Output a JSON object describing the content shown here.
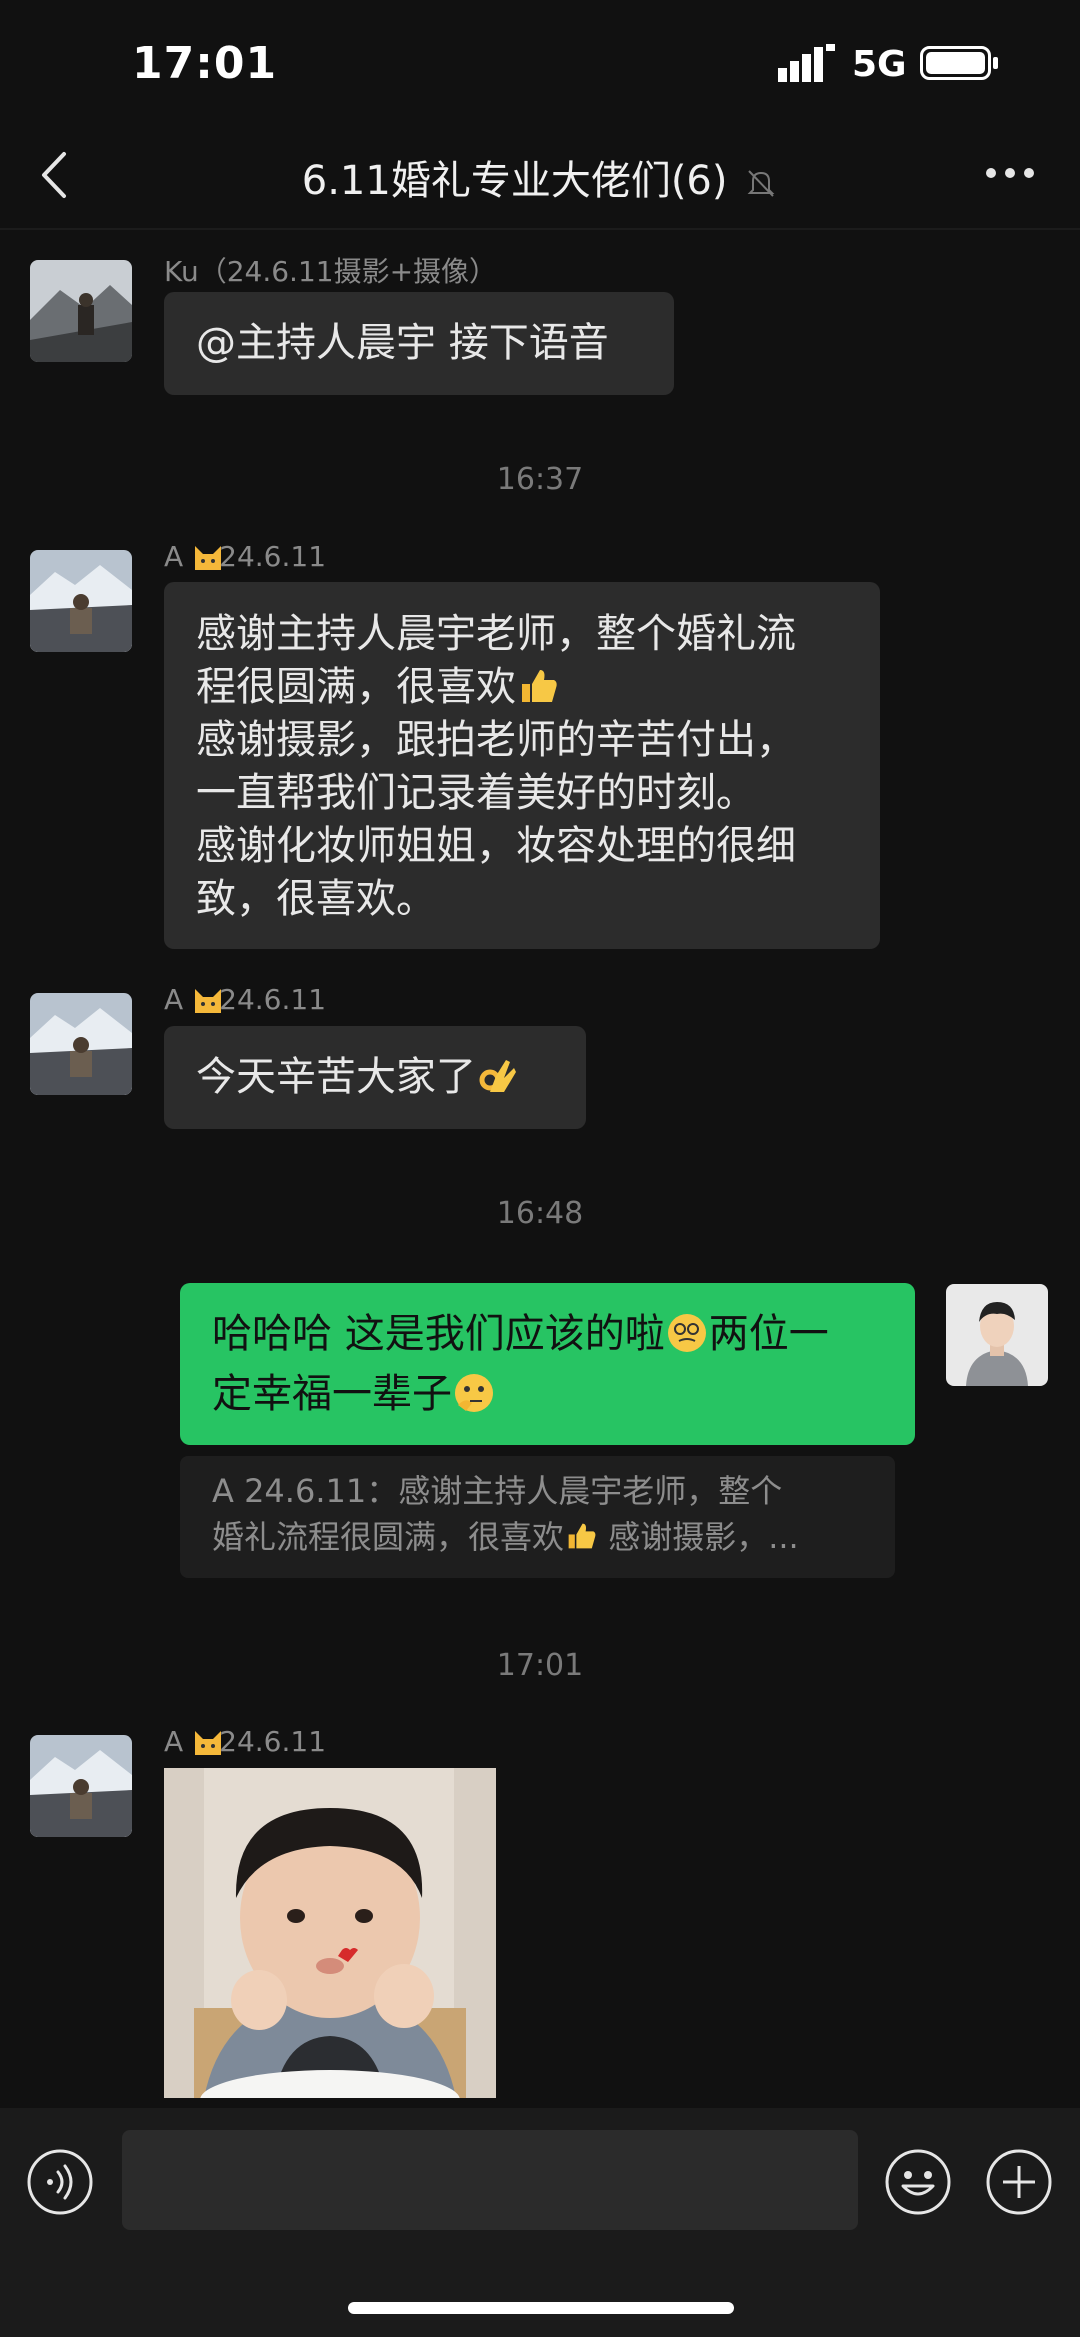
{
  "status_bar": {
    "time": "17:01",
    "network": "5G"
  },
  "nav": {
    "title": "6.11婚礼专业大佬们(6)"
  },
  "messages": {
    "m1": {
      "sender": "Ku（24.6.11摄影+摄像）",
      "text": "@主持人晨宇 接下语音"
    },
    "t1": "16:37",
    "m2": {
      "sender": "A 24.6.11",
      "lines": [
        "感谢主持人晨宇老师，整个婚礼流",
        "程很圆满，很喜欢",
        "感谢摄影，跟拍老师的辛苦付出，",
        "一直帮我们记录着美好的时刻。",
        "感谢化妆师姐姐，妆容处理的很细",
        "致，很喜欢。"
      ]
    },
    "m3": {
      "sender": "A 24.6.11",
      "text": "今天辛苦大家了"
    },
    "t2": "16:48",
    "m4": {
      "lines": [
        "哈哈哈 这是我们应该的啦",
        "两位一",
        "定幸福一辈子"
      ],
      "quote_line1": "A 24.6.11：感谢主持人晨宇老师，整个",
      "quote_line2a": "婚礼流程很圆满，很喜欢",
      "quote_line2b": " 感谢摄影，..."
    },
    "t3": "17:01",
    "m5": {
      "sender": "A 24.6.11"
    }
  },
  "icons": {
    "back": "chevron-left-icon",
    "more": "more-dots-icon",
    "mute": "bell-off-icon",
    "voice": "voice-icon",
    "emoji": "emoji-icon",
    "plus": "plus-icon"
  },
  "colors": {
    "background": "#111111",
    "bubble_other": "#2c2c2c",
    "bubble_me": "#27c463"
  }
}
